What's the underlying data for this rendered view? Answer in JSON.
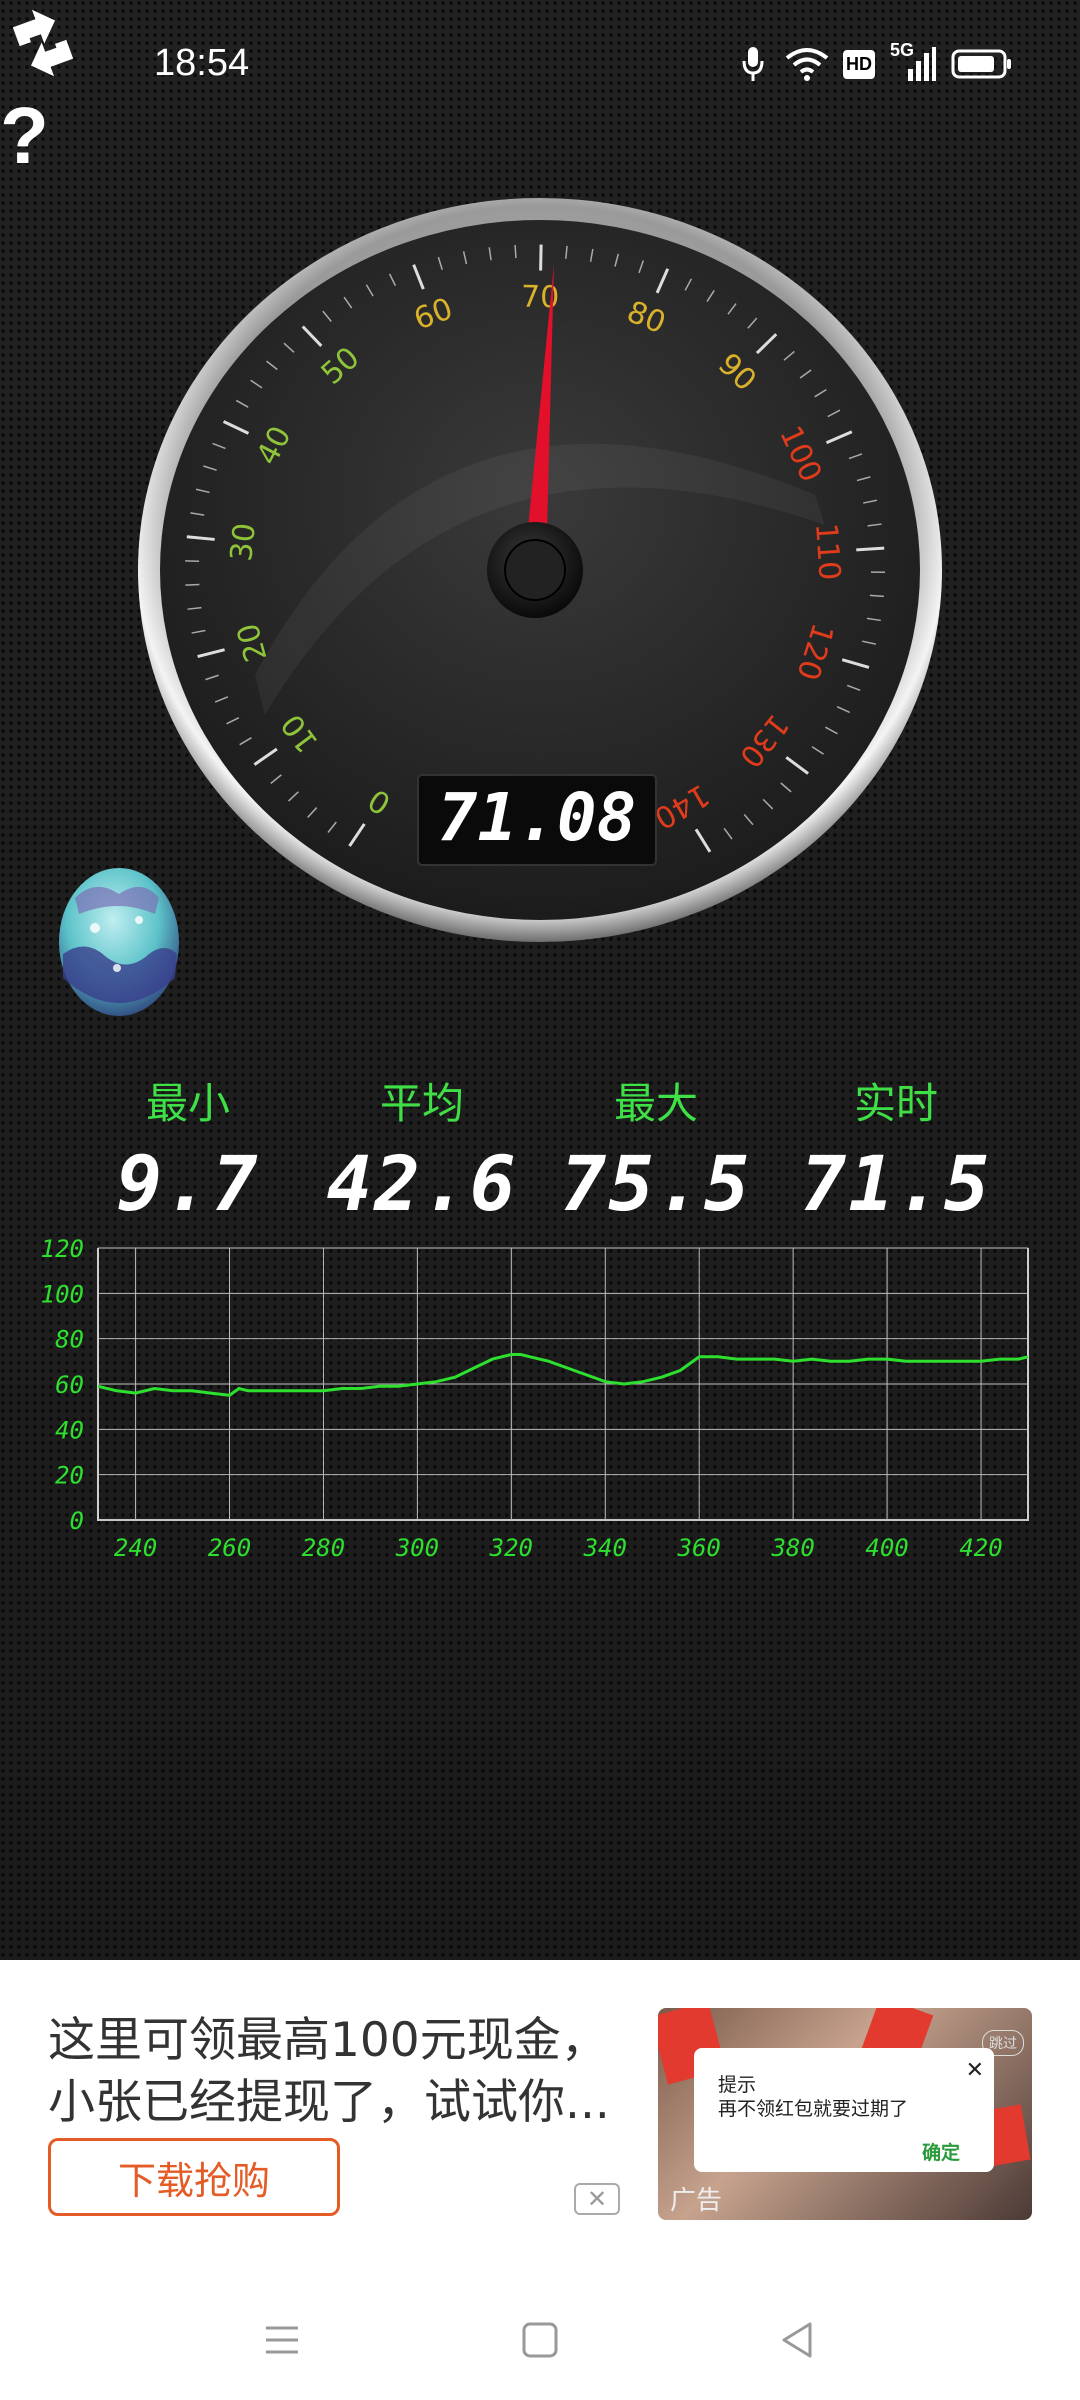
{
  "status_bar": {
    "time": "18:54",
    "icons": [
      "microphone-icon",
      "wifi-icon",
      "hd-icon",
      "5g-signal-icon",
      "battery-icon"
    ],
    "hd_label": "HD",
    "network_label": "5G"
  },
  "buttons": {
    "refresh_icon": "refresh-icon",
    "help_icon": "help-icon",
    "help_glyph": "?"
  },
  "gauge": {
    "min": 0,
    "max": 140,
    "value": 71.08,
    "digital_readout": "71.08",
    "tick_labels": [
      "0",
      "10",
      "20",
      "30",
      "40",
      "50",
      "60",
      "70",
      "80",
      "90",
      "100",
      "110",
      "120",
      "130",
      "140"
    ],
    "colors": {
      "green": "#8fc43a",
      "yellow": "#d9b12a",
      "red": "#e03c1c",
      "needle": "#e2102a"
    }
  },
  "stats": {
    "min": {
      "label": "最小",
      "value": "9.7"
    },
    "avg": {
      "label": "平均",
      "value": "42.6"
    },
    "max": {
      "label": "最大",
      "value": "75.5"
    },
    "live": {
      "label": "实时",
      "value": "71.5"
    }
  },
  "chart_data": {
    "type": "line",
    "x_ticks": [
      "240",
      "260",
      "280",
      "300",
      "320",
      "340",
      "360",
      "380",
      "400",
      "420"
    ],
    "y_ticks": [
      "0",
      "20",
      "40",
      "60",
      "80",
      "100",
      "120"
    ],
    "xlim": [
      232,
      430
    ],
    "ylim": [
      0,
      120
    ],
    "grid": true,
    "line_color": "#2ee02e",
    "x": [
      232,
      236,
      240,
      244,
      248,
      252,
      256,
      260,
      262,
      264,
      268,
      272,
      276,
      280,
      284,
      288,
      292,
      296,
      300,
      304,
      308,
      312,
      316,
      320,
      322,
      324,
      328,
      332,
      336,
      340,
      344,
      348,
      352,
      356,
      360,
      364,
      368,
      372,
      376,
      380,
      384,
      388,
      392,
      396,
      400,
      404,
      408,
      412,
      416,
      420,
      424,
      428,
      430
    ],
    "values": [
      59,
      57,
      56,
      58,
      57,
      57,
      56,
      55,
      58,
      57,
      57,
      57,
      57,
      57,
      58,
      58,
      59,
      59,
      60,
      61,
      63,
      67,
      71,
      73,
      73,
      72,
      70,
      67,
      64,
      61,
      60,
      61,
      63,
      66,
      72,
      72,
      71,
      71,
      71,
      70,
      71,
      70,
      70,
      71,
      71,
      70,
      70,
      70,
      70,
      70,
      71,
      71,
      72
    ]
  },
  "ad": {
    "text": "这里可领最高100元现金，小张已经提现了，试试你...",
    "download_label": "下载抢购",
    "close_glyph": "✕",
    "dialog_title": "提示",
    "dialog_message": "再不领红包就要过期了",
    "dialog_ok": "确定",
    "dialog_close_glyph": "✕",
    "ad_label": "广告",
    "skip_label": "跳过"
  },
  "nav_bar": {
    "icons": [
      "menu-icon",
      "home-icon",
      "back-icon"
    ]
  }
}
